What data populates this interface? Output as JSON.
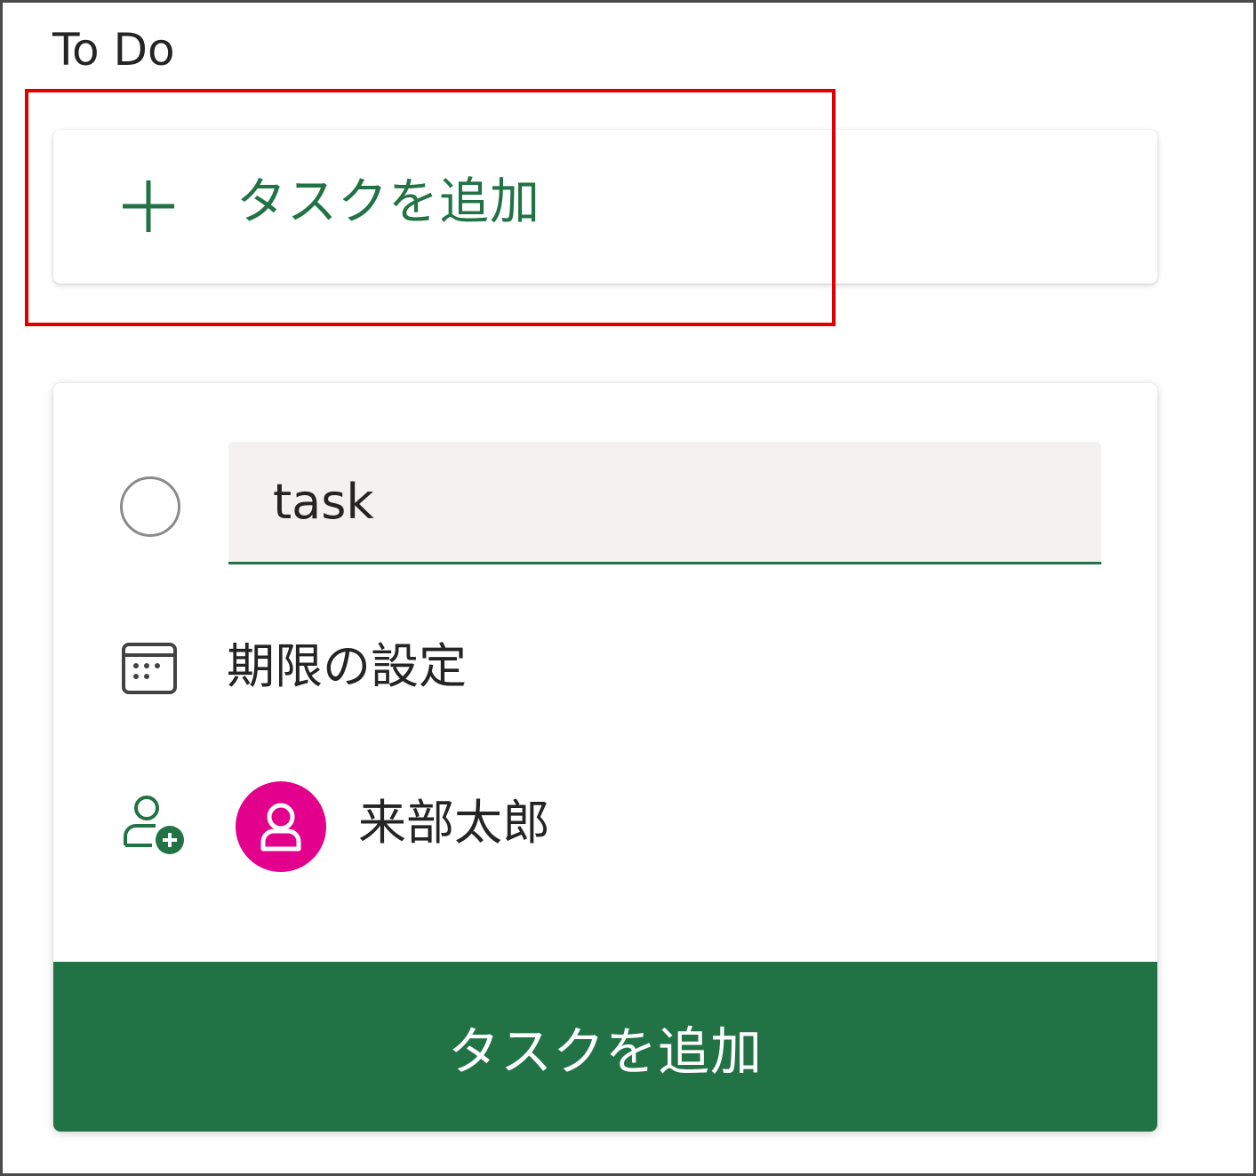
{
  "column": {
    "title": "To Do"
  },
  "add_task_row": {
    "label": "タスクを追加",
    "icon": "plus-icon"
  },
  "new_task_card": {
    "title_input_value": "task",
    "due_date_label": "期限の設定",
    "assignee": {
      "name": "来部太郎",
      "avatar_color": "#e3008c"
    },
    "submit_label": "タスクを追加"
  },
  "colors": {
    "accent": "#217346",
    "highlight": "#e00000",
    "input_background": "#f3f2f1"
  }
}
